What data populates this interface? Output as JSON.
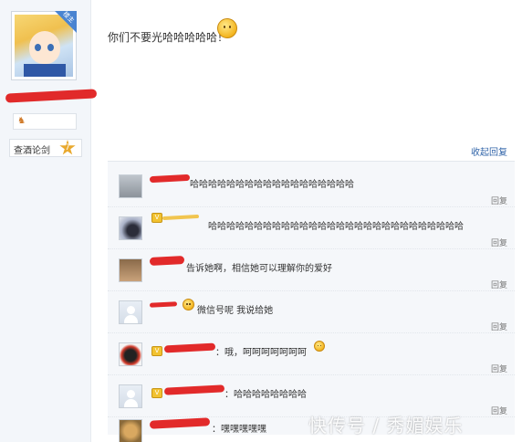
{
  "author": {
    "badge": "楼主",
    "tag_text": "查酒论剑",
    "tag_level": "7"
  },
  "post": {
    "text": "你们不要光哈哈哈哈哈！"
  },
  "top_actions": {
    "collapse_reply": "收起回复"
  },
  "comments": [
    {
      "text": "哈哈哈哈哈哈哈哈哈哈哈哈哈哈哈哈哈哈",
      "reply": "回复"
    },
    {
      "text": "哈哈哈哈哈哈哈哈哈哈哈哈哈哈哈哈哈哈哈哈哈哈哈哈哈哈哈哈",
      "reply": "回复"
    },
    {
      "text": "告诉她啊，相信她可以理解你的爱好",
      "reply": "回复"
    },
    {
      "text": "微信号呢 我说给她",
      "reply": "回复"
    },
    {
      "text": "：哦，呵呵呵呵呵呵呵",
      "reply": "回复"
    },
    {
      "text": "：哈哈哈哈哈哈哈哈",
      "reply": "回复"
    },
    {
      "text": "：嘿嘿嘿嘿嘿",
      "reply": "回复"
    }
  ],
  "watermark": "快传号 / 秀媚娱乐",
  "colors": {
    "link": "#3366aa",
    "redaction": "#e01818",
    "panel_bg": "#f5f7fa"
  }
}
